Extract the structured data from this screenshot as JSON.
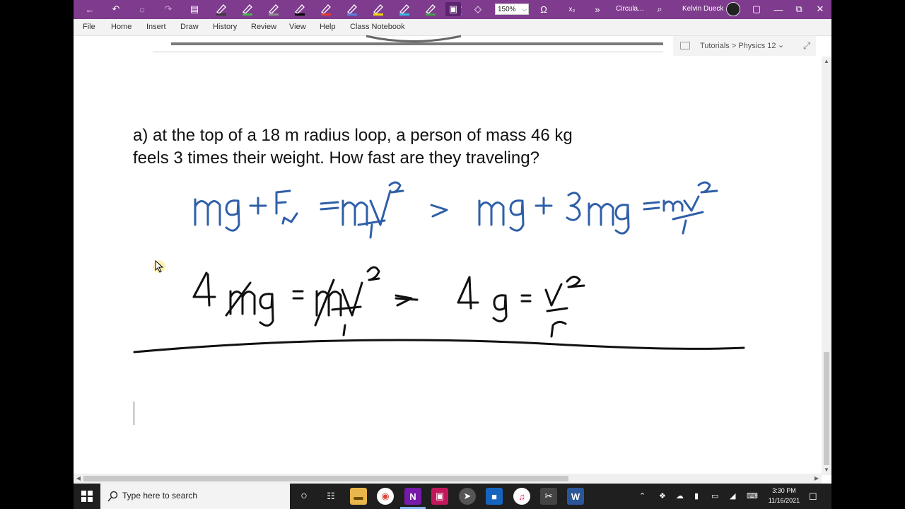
{
  "titlebar": {
    "zoom": "150%",
    "page_title": "Circula...",
    "user_name": "Kelvin Dueck",
    "subscript_label": "x₂",
    "more_label": "»",
    "pen_colors": [
      "#3a3a3a",
      "#4caf50",
      "#8e8e8e",
      "#000000",
      "#e53935",
      "#5a7de0",
      "#f2d600",
      "#31b8e6",
      "#43a047",
      "#d63fd6"
    ]
  },
  "menu": [
    "File",
    "Home",
    "Insert",
    "Draw",
    "History",
    "Review",
    "View",
    "Help",
    "Class Notebook"
  ],
  "breadcrumb": {
    "text": "Tutorials > Physics 12"
  },
  "question": {
    "line1": "a) at the top of a 18 m radius loop, a person of mass 46 kg",
    "line2": "feels 3 times their weight. How fast are they traveling?"
  },
  "taskbar": {
    "search_placeholder": "Type here to search",
    "time": "3:30 PM",
    "date": "11/16/2021"
  }
}
